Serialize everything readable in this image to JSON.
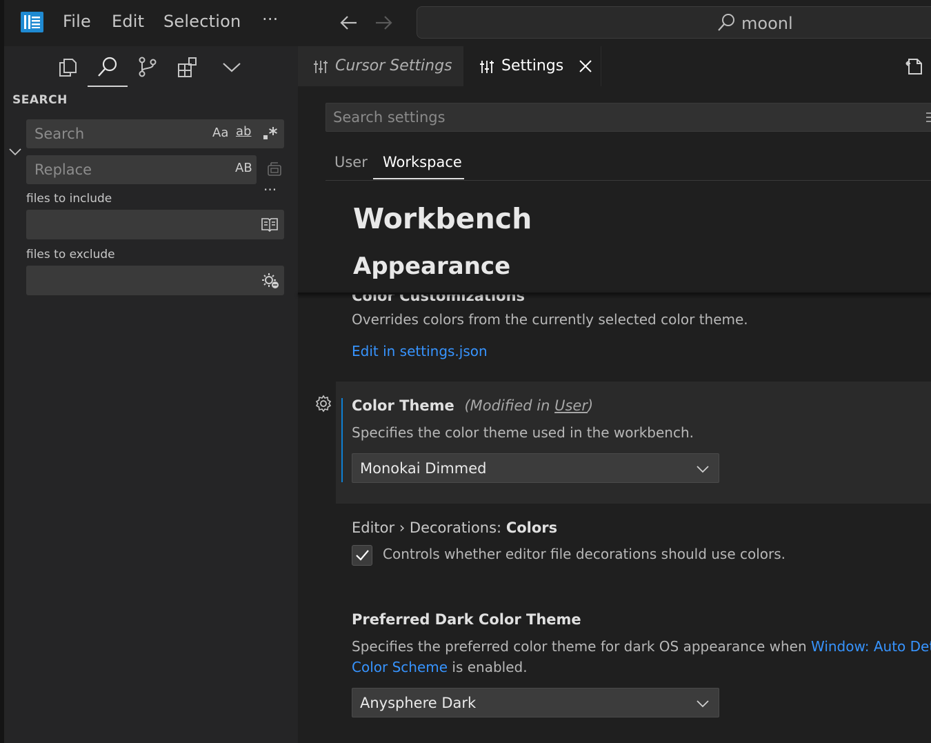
{
  "menu": {
    "file": "File",
    "edit": "Edit",
    "selection": "Selection",
    "more": "···"
  },
  "command_center": {
    "query": "moonl"
  },
  "sidebar": {
    "title": "SEARCH",
    "search": {
      "placeholder": "Search",
      "match_case": "Aa",
      "whole_word": "ab",
      "regex": ".*"
    },
    "replace": {
      "placeholder": "Replace",
      "preserve_case": "AB"
    },
    "more": "···",
    "files_include_label": "files to include",
    "files_exclude_label": "files to exclude"
  },
  "tabs": [
    {
      "label": "Cursor Settings",
      "active": false
    },
    {
      "label": "Settings",
      "active": true
    }
  ],
  "settings": {
    "search_placeholder": "Search settings",
    "scopes": [
      "User",
      "Workspace"
    ],
    "active_scope": "Workspace",
    "heading": "Workbench",
    "subheading": "Appearance",
    "color_customizations": {
      "title": "Color Customizations",
      "description": "Overrides colors from the currently selected color theme.",
      "link": "Edit in settings.json"
    },
    "color_theme": {
      "title": "Color Theme",
      "modified_prefix": "(Modified in ",
      "modified_scope": "User",
      "modified_suffix": ")",
      "description": "Specifies the color theme used in the workbench.",
      "value": "Monokai Dimmed"
    },
    "decorations_colors": {
      "category": "Editor › Decorations: ",
      "name": "Colors",
      "checked": true,
      "description": "Controls whether editor file decorations should use colors."
    },
    "preferred_dark": {
      "title": "Preferred Dark Color Theme",
      "description_before": "Specifies the preferred color theme for dark OS appearance when ",
      "link_part1": "Window: Auto Detect",
      "link_part2": "Color Scheme",
      "description_after": " is enabled.",
      "value": "Anysphere Dark"
    }
  },
  "colors": {
    "accent_link": "#3794ff",
    "focus_bar": "#0e7fd3",
    "logo": "#1f8ad2"
  }
}
